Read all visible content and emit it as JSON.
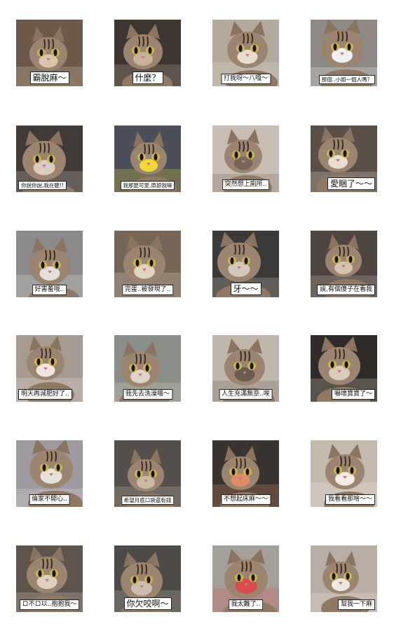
{
  "colors": {
    "background": "#ffffff",
    "caption_bg": "#ffffff",
    "caption_text": "#111111",
    "caption_border": "#222222"
  },
  "stickers": [
    {
      "caption": "霸脫麻～",
      "scene": "cat-closeup-pink-cheeks",
      "bg": "#6b5a4c",
      "accent": "#d9c4b0"
    },
    {
      "caption": "什麼？",
      "scene": "cat-lying-tilted",
      "bg": "#3d3530",
      "accent": "#c9b29a"
    },
    {
      "caption": "打我呀～八嘎～",
      "scene": "cat-face-laughing",
      "bg": "#b3a99c",
      "accent": "#e6dccf"
    },
    {
      "caption": "那個..小姐一個人嗎？",
      "scene": "cat-sunglasses",
      "bg": "#8f8a86",
      "accent": "#f0f0f0"
    },
    {
      "caption": "你說你說,我在聽!!",
      "scene": "cat-sitting",
      "bg": "#403b37",
      "accent": "#d8cdbf"
    },
    {
      "caption": "我那麼可愛,原諒我嘛",
      "scene": "cat-yellow-bib",
      "bg": "#4a4f5a",
      "accent": "#f2d633"
    },
    {
      "caption": "突然想上廁所..",
      "scene": "cat-closeup-side",
      "bg": "#c7bdb2",
      "accent": "#7a6656"
    },
    {
      "caption": "愛睏了～～",
      "scene": "cat-yawning",
      "bg": "#5b5047",
      "accent": "#e8ddd0"
    },
    {
      "caption": "好害羞哦..",
      "scene": "cat-paws-up",
      "bg": "#8d8a8b",
      "accent": "#e3dfdc"
    },
    {
      "caption": "完蛋..被發現了..",
      "scene": "cat-closeup-face",
      "bg": "#766657",
      "accent": "#e0d3c4"
    },
    {
      "caption": "牙～～",
      "scene": "cat-rolling",
      "bg": "#3c3a38",
      "accent": "#d3c8bb"
    },
    {
      "caption": "誒,有個傻子在看我",
      "scene": "cat-lying-flower",
      "bg": "#4e4540",
      "accent": "#d5c3b2"
    },
    {
      "caption": "明天再減肥好了..",
      "scene": "cat-belly-up",
      "bg": "#a69a91",
      "accent": "#efe7df"
    },
    {
      "caption": "我先去洗澡喵～",
      "scene": "cat-head-tilt",
      "bg": "#8b8f8a",
      "accent": "#ddd2c4"
    },
    {
      "caption": "人生充滿無奈..唉",
      "scene": "cat-window-sit",
      "bg": "#bfb7ac",
      "accent": "#6b5c4f"
    },
    {
      "caption": "嚇壞寶寶了～",
      "scene": "cat-big-eyes",
      "bg": "#2f2b28",
      "accent": "#d9cbbb"
    },
    {
      "caption": "倫家不開心..",
      "scene": "cat-blanket",
      "bg": "#9e9aa0",
      "accent": "#e7e1dc"
    },
    {
      "caption": "希望月底口袋還有錢",
      "scene": "cat-fence",
      "bg": "#55504c",
      "accent": "#cabba9"
    },
    {
      "caption": "不想起床麻～～",
      "scene": "cat-plush-toy",
      "bg": "#3a3431",
      "accent": "#e08a6a"
    },
    {
      "caption": "我看看那啥～～",
      "scene": "cat-upright",
      "bg": "#c4b9ad",
      "accent": "#f3ece4"
    },
    {
      "caption": "ロ不ロ以..抱抱我～",
      "scene": "cat-lying-look",
      "bg": "#5e544c",
      "accent": "#ddd0c1"
    },
    {
      "caption": "你欠咬啊～",
      "scene": "cat-biting",
      "bg": "#4d4a47",
      "accent": "#cbbeb1"
    },
    {
      "caption": "我太難了..",
      "scene": "cat-wall-numbers",
      "bg": "#a59f99",
      "accent": "#d94c4c"
    },
    {
      "caption": "幫我一下麻",
      "scene": "cat-sleepy",
      "bg": "#b8aea5",
      "accent": "#efe8e1"
    }
  ]
}
